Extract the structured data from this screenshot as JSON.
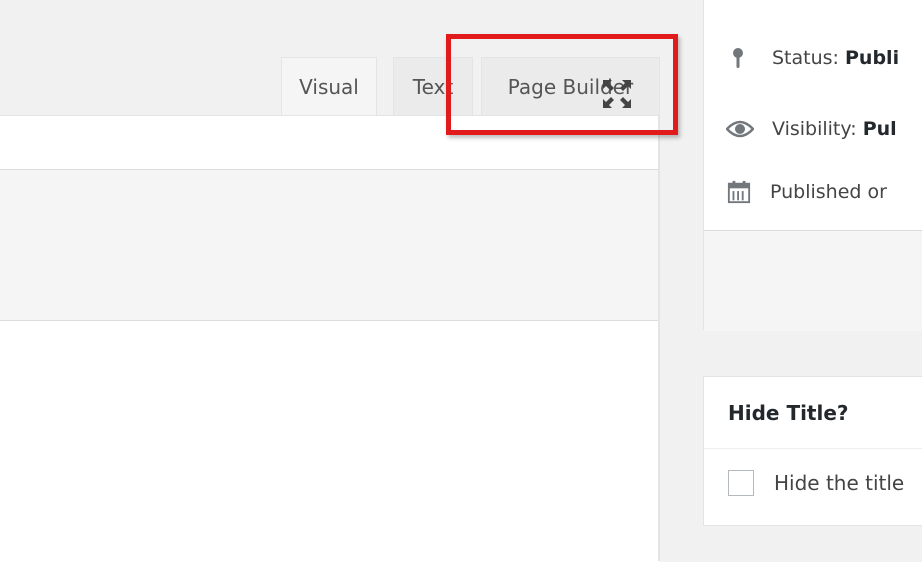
{
  "editor": {
    "tabs": [
      {
        "label": "Visual"
      },
      {
        "label": "Text"
      },
      {
        "label": "Page Builder"
      }
    ]
  },
  "publish": {
    "status_label": "Status:",
    "status_value": "Publi",
    "visibility_label": "Visibility:",
    "visibility_value": "Pul",
    "published_label": "Published or"
  },
  "hide_title": {
    "heading": "Hide Title?",
    "checkbox_label": "Hide the title"
  },
  "colors": {
    "highlight": "#e11b1b",
    "icon": "#72777c"
  }
}
